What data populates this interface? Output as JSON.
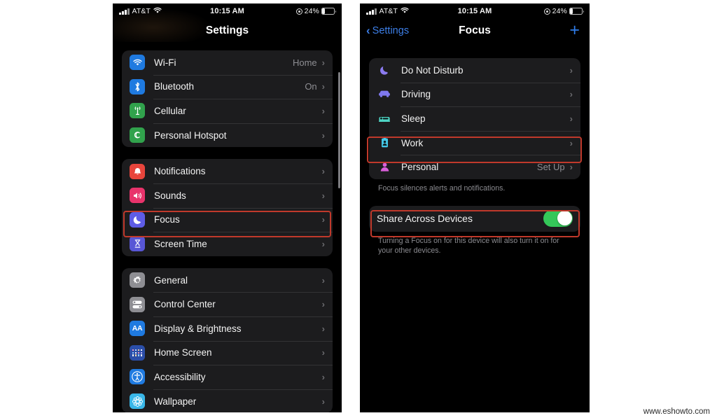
{
  "watermark": "www.eshowto.com",
  "accent": {
    "red_box": "#c0392b",
    "ios_blue": "#3d7fe8",
    "toggle_green": "#34c759"
  },
  "left_phone": {
    "status_bar": {
      "signal_icon": "cellular-bars-icon",
      "carrier": "AT&T",
      "wifi_icon": "wifi-icon",
      "time": "10:15 AM",
      "location_icon": "location-services-icon",
      "battery_percent": "24%",
      "battery_icon": "battery-low-icon"
    },
    "nav": {
      "title": "Settings"
    },
    "groups": [
      {
        "rows": [
          {
            "icon": "wifi-icon",
            "icon_color": "#1f7ae0",
            "label": "Wi-Fi",
            "value": "Home",
            "chevron": "›"
          },
          {
            "icon": "bluetooth-icon",
            "icon_color": "#1f7ae0",
            "label": "Bluetooth",
            "value": "On",
            "chevron": "›"
          },
          {
            "icon": "cellular-tower-icon",
            "icon_color": "#31a24c",
            "label": "Cellular",
            "value": "",
            "chevron": "›"
          },
          {
            "icon": "personal-hotspot-icon",
            "icon_color": "#31a24c",
            "label": "Personal Hotspot",
            "value": "",
            "chevron": "›"
          }
        ]
      },
      {
        "rows": [
          {
            "icon": "bell-icon",
            "icon_color": "#e8453c",
            "label": "Notifications",
            "value": "",
            "chevron": "›"
          },
          {
            "icon": "speaker-icon",
            "icon_color": "#e8336b",
            "label": "Sounds",
            "value": "",
            "chevron": "›"
          },
          {
            "icon": "moon-icon",
            "icon_color": "#5e5ce6",
            "label": "Focus",
            "value": "",
            "chevron": "›",
            "highlighted": true
          },
          {
            "icon": "hourglass-icon",
            "icon_color": "#5856d6",
            "label": "Screen Time",
            "value": "",
            "chevron": "›"
          }
        ]
      },
      {
        "rows": [
          {
            "icon": "gear-icon",
            "icon_color": "#8e8e93",
            "label": "General",
            "value": "",
            "chevron": "›"
          },
          {
            "icon": "toggles-icon",
            "icon_color": "#8e8e93",
            "label": "Control Center",
            "value": "",
            "chevron": "›"
          },
          {
            "icon": "text-size-icon",
            "icon_color": "#1f7ae0",
            "label": "Display & Brightness",
            "value": "",
            "chevron": "›"
          },
          {
            "icon": "home-screen-icon",
            "icon_color": "#2b4ea8",
            "label": "Home Screen",
            "value": "",
            "chevron": "›"
          },
          {
            "icon": "accessibility-icon",
            "icon_color": "#1f7ae0",
            "label": "Accessibility",
            "value": "",
            "chevron": "›"
          },
          {
            "icon": "wallpaper-icon",
            "icon_color": "#39b7e8",
            "label": "Wallpaper",
            "value": "",
            "chevron": "›"
          }
        ]
      }
    ]
  },
  "right_phone": {
    "status_bar": {
      "signal_icon": "cellular-bars-icon",
      "carrier": "AT&T",
      "wifi_icon": "wifi-icon",
      "time": "10:15 AM",
      "location_icon": "location-services-icon",
      "battery_percent": "24%",
      "battery_icon": "battery-low-icon"
    },
    "nav": {
      "back_label": "Settings",
      "title": "Focus",
      "add_label": "+"
    },
    "focus_rows": [
      {
        "icon": "moon-icon",
        "icon_color": "#8b7bf0",
        "label": "Do Not Disturb",
        "value": "",
        "chevron": "›"
      },
      {
        "icon": "car-icon",
        "icon_color": "#7f78ef",
        "label": "Driving",
        "value": "",
        "chevron": "›"
      },
      {
        "icon": "bed-icon",
        "icon_color": "#4fd4c4",
        "label": "Sleep",
        "value": "",
        "chevron": "›"
      },
      {
        "icon": "id-badge-icon",
        "icon_color": "#45c8e8",
        "label": "Work",
        "value": "",
        "chevron": "›",
        "highlighted": true
      },
      {
        "icon": "person-icon",
        "icon_color": "#d95fd9",
        "label": "Personal",
        "value": "Set Up",
        "chevron": "›"
      }
    ],
    "focus_footnote": "Focus silences alerts and notifications.",
    "share_row": {
      "label": "Share Across Devices",
      "toggle_on": true
    },
    "share_footnote": "Turning a Focus on for this device will also turn it on for your other devices."
  }
}
